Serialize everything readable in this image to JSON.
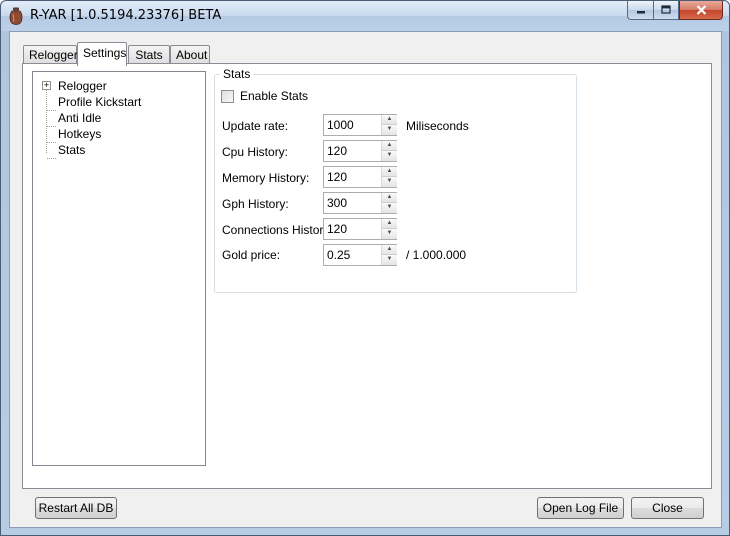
{
  "window": {
    "title": "R-YAR [1.0.5194.23376] BETA",
    "icon": "jar-icon"
  },
  "tabs": [
    {
      "label": "Relogger"
    },
    {
      "label": "Settings",
      "active": true
    },
    {
      "label": "Stats"
    },
    {
      "label": "About"
    }
  ],
  "tree": {
    "items": [
      {
        "label": "Relogger",
        "expandable": true
      },
      {
        "label": "Profile Kickstart"
      },
      {
        "label": "Anti Idle"
      },
      {
        "label": "Hotkeys"
      },
      {
        "label": "Stats"
      }
    ]
  },
  "stats_group": {
    "title": "Stats",
    "enable_label": "Enable Stats",
    "enable_checked": false,
    "fields": [
      {
        "label": "Update rate:",
        "value": "1000",
        "suffix": "Miliseconds"
      },
      {
        "label": "Cpu History:",
        "value": "120"
      },
      {
        "label": "Memory History:",
        "value": "120"
      },
      {
        "label": "Gph History:",
        "value": "300"
      },
      {
        "label": "Connections History:",
        "value": "120"
      },
      {
        "label": "Gold price:",
        "value": "0.25",
        "suffix": "/ 1.000.000"
      }
    ]
  },
  "footer": {
    "restart_label": "Restart All DB",
    "open_log_label": "Open Log File",
    "close_label": "Close"
  },
  "colors": {
    "accent_title": "#bcd1e9",
    "close_button": "#c4452b"
  }
}
